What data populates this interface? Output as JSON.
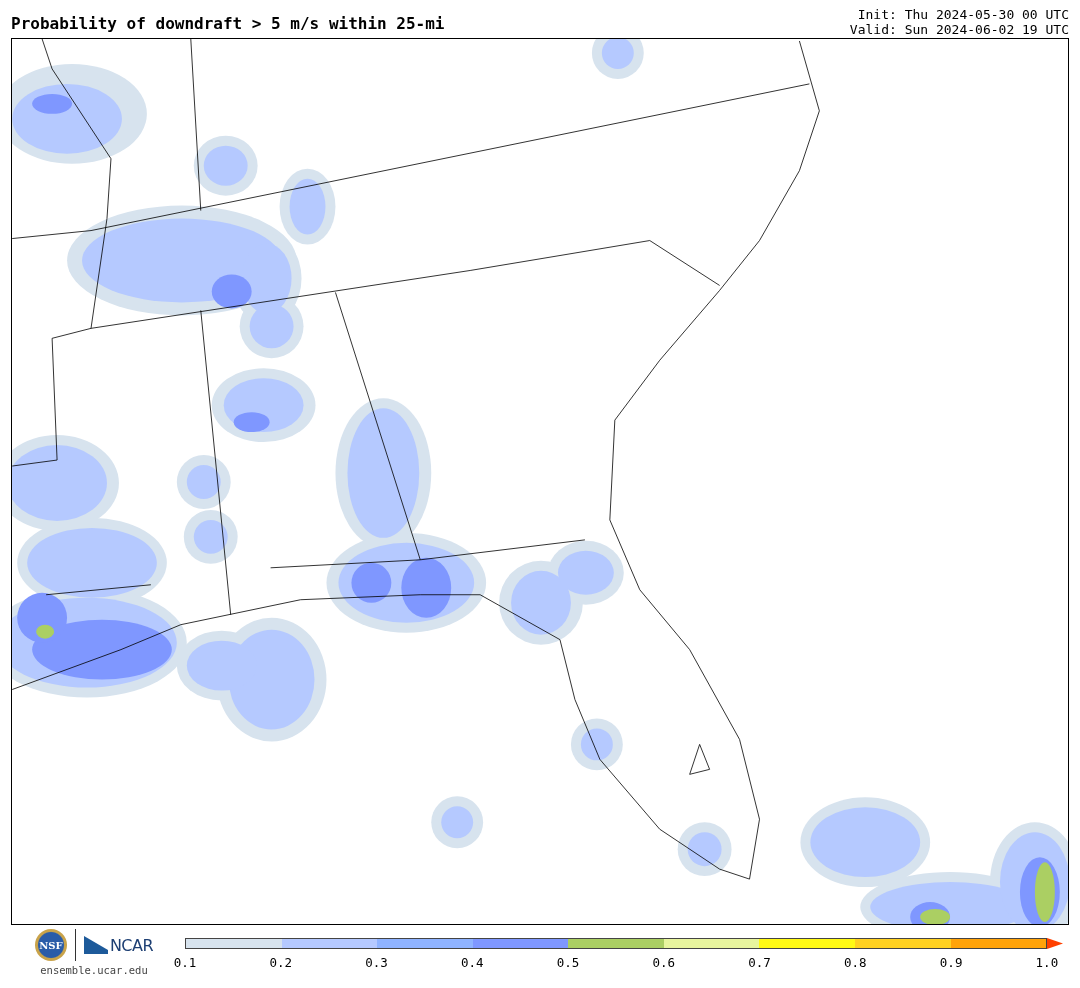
{
  "title": "Probability of downdraft > 5 m/s within 25-mi",
  "init": "Init: Thu 2024-05-30 00 UTC",
  "valid": "Valid: Sun 2024-06-02 19 UTC",
  "logo": {
    "nsf": "NSF",
    "ncar": "NCAR",
    "site": "ensemble.ucar.edu"
  },
  "colorbar": {
    "segments": [
      {
        "kind": "band",
        "color": "#d7e3ee"
      },
      {
        "kind": "band",
        "color": "#b5c9ff"
      },
      {
        "kind": "band",
        "color": "#8fb3ff"
      },
      {
        "kind": "band",
        "color": "#7f97ff"
      },
      {
        "kind": "band",
        "color": "#abcf63"
      },
      {
        "kind": "band",
        "color": "#e8f59e"
      },
      {
        "kind": "band",
        "color": "#fffa14"
      },
      {
        "kind": "band",
        "color": "#ffd121"
      },
      {
        "kind": "band",
        "color": "#ffa30a"
      },
      {
        "kind": "arrow",
        "color": "#ff4000"
      }
    ],
    "ticks": [
      "0.1",
      "0.2",
      "0.3",
      "0.4",
      "0.5",
      "0.6",
      "0.7",
      "0.8",
      "0.9",
      "1.0"
    ]
  }
}
